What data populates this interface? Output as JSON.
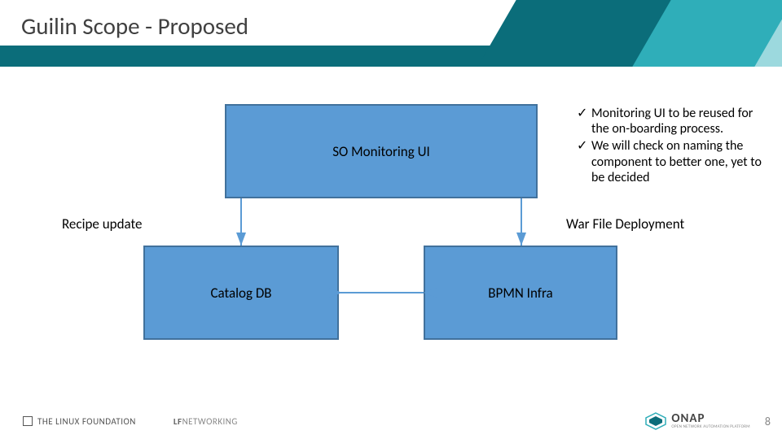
{
  "header": {
    "title": "Guilin Scope  - Proposed"
  },
  "boxes": {
    "so_monitoring": "SO Monitoring UI",
    "catalog_db": "Catalog DB",
    "bpmn_infra": "BPMN Infra"
  },
  "labels": {
    "recipe_update": "Recipe update",
    "war_file_deployment": "War File Deployment"
  },
  "bullets": [
    "Monitoring UI to be reused for the on-boarding process.",
    "We will check on naming the component to better one, yet to be decided"
  ],
  "footer": {
    "lf": "THE LINUX FOUNDATION",
    "lfnet_prefix": "LF",
    "lfnet_rest": "NETWORKING",
    "onap": "ONAP",
    "onap_sub": "OPEN NETWORK AUTOMATION PLATFORM",
    "page_number": "8"
  },
  "chart_data": {
    "type": "diagram",
    "title": "Guilin Scope  - Proposed",
    "nodes": [
      {
        "id": "so_monitoring",
        "label": "SO Monitoring UI"
      },
      {
        "id": "catalog_db",
        "label": "Catalog DB"
      },
      {
        "id": "bpmn_infra",
        "label": "BPMN Infra"
      }
    ],
    "edges": [
      {
        "from": "so_monitoring",
        "to": "catalog_db",
        "label": "Recipe update",
        "bidirectional": false
      },
      {
        "from": "so_monitoring",
        "to": "bpmn_infra",
        "label": "War File Deployment",
        "bidirectional": false
      },
      {
        "from": "bpmn_infra",
        "to": "catalog_db",
        "bidirectional": true
      }
    ],
    "annotations": [
      "Monitoring UI to be reused for the on-boarding process.",
      "We will check on naming the component to better one, yet to be decided"
    ]
  }
}
